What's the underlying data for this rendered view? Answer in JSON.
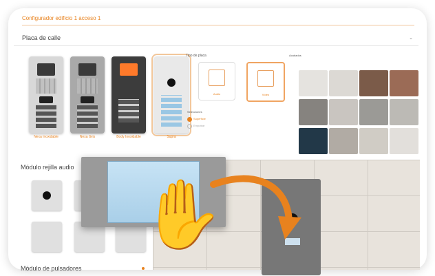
{
  "header": {
    "title": "Configurador edificio 1 acceso 1",
    "section": "Placa de calle"
  },
  "plates": [
    {
      "label": "Nexa Inoxidable"
    },
    {
      "label": "Nexa Gris"
    },
    {
      "label": "Body Inoxidable"
    },
    {
      "label": "Supra"
    }
  ],
  "plate_type": {
    "label": "Tipo de placa",
    "options": [
      {
        "label": "Audio"
      },
      {
        "label": "Vídeo"
      }
    ]
  },
  "selection": {
    "label": "Selecciones",
    "options": [
      {
        "label": "Superficie",
        "selected": true
      },
      {
        "label": "Empotrar",
        "selected": false
      }
    ]
  },
  "finishes": {
    "label": "Acabados",
    "swatches": [
      {
        "color": "#e5e3df"
      },
      {
        "color": "#dcd9d4"
      },
      {
        "color": "#7b5b49"
      },
      {
        "color": "#9b6b56"
      },
      {
        "color": "#86837f"
      },
      {
        "color": "#c9c5c0"
      },
      {
        "color": "#9b9a96"
      },
      {
        "color": "#bcbab5"
      },
      {
        "color": "#223848"
      },
      {
        "color": "#b1aba4"
      },
      {
        "color": "#d0ccc5"
      },
      {
        "color": "#e2dfdb"
      }
    ]
  },
  "modules": {
    "label": "Módulo rejilla audio",
    "pulsadores_label": "Módulo de pulsadores"
  },
  "colors": {
    "accent": "#e8821e"
  },
  "icons": {
    "hand": "hand-drag-icon",
    "arrow": "curved-arrow-icon"
  }
}
